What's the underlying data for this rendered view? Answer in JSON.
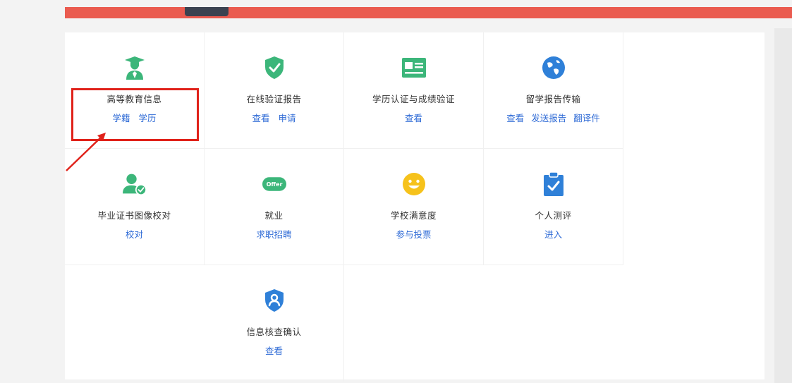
{
  "colors": {
    "brand_bar": "#ea5b4f",
    "icon_green": "#3cb67a",
    "icon_blue": "#2f80d8",
    "icon_yellow": "#f6c21b",
    "link_blue": "#2f6bd6",
    "annotation_red": "#e0221a"
  },
  "services": [
    {
      "icon": "graduate-icon",
      "title": "高等教育信息",
      "links": [
        "学籍",
        "学历"
      ]
    },
    {
      "icon": "shield-check-icon",
      "title": "在线验证报告",
      "links": [
        "查看",
        "申请"
      ]
    },
    {
      "icon": "id-card-icon",
      "title": "学历认证与成绩验证",
      "links": [
        "查看"
      ]
    },
    {
      "icon": "globe-icon",
      "title": "留学报告传输",
      "links": [
        "查看",
        "发送报告",
        "翻译件"
      ]
    },
    {
      "icon": "user-check-icon",
      "title": "毕业证书图像校对",
      "links": [
        "校对"
      ]
    },
    {
      "icon": "offer-icon",
      "title": "就业",
      "links": [
        "求职招聘"
      ]
    },
    {
      "icon": "smiley-icon",
      "title": "学校满意度",
      "links": [
        "参与投票"
      ]
    },
    {
      "icon": "clipboard-check-icon",
      "title": "个人测评",
      "links": [
        "进入"
      ]
    },
    {
      "icon": "shield-user-icon",
      "title": "信息核查确认",
      "links": [
        "查看"
      ]
    }
  ],
  "offer_badge_text": "Offer"
}
